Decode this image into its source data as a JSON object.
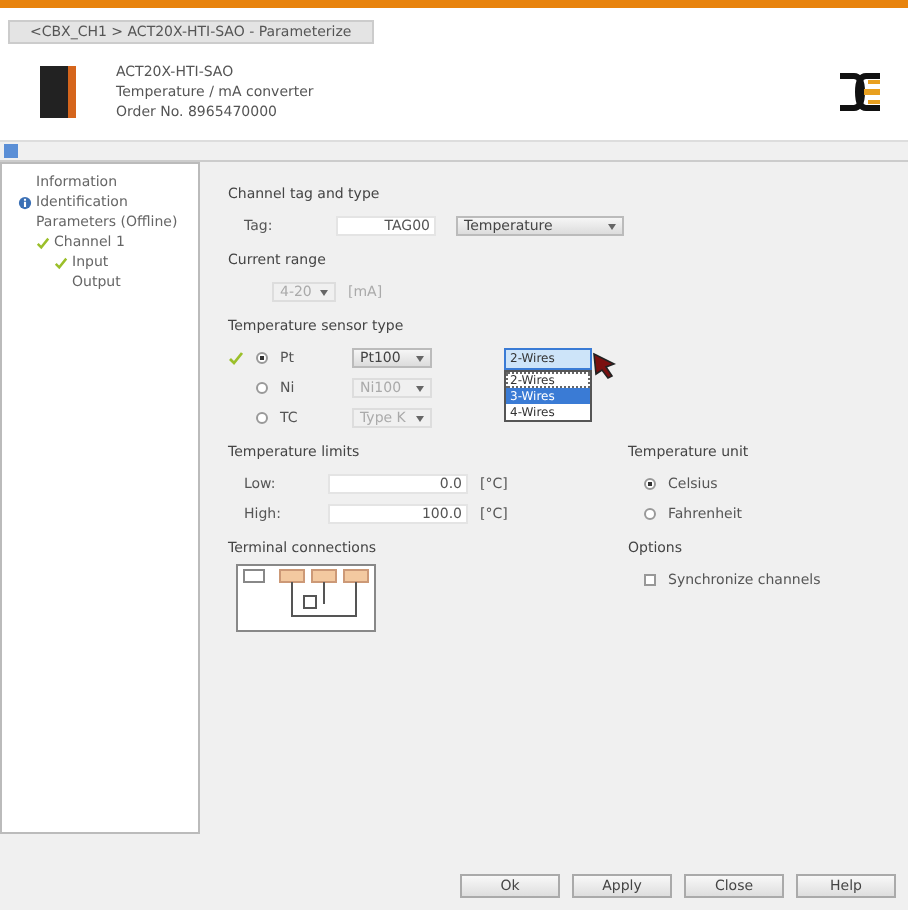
{
  "window": {
    "title": "<CBX_CH1 > ACT20X-HTI-SAO - Parameterize"
  },
  "device": {
    "model": "ACT20X-HTI-SAO",
    "description": "Temperature / mA converter",
    "order_no": "Order No. 8965470000"
  },
  "tree": [
    {
      "label": "Information",
      "kind": "plain"
    },
    {
      "label": "Identification",
      "kind": "info"
    },
    {
      "label": "Parameters (Offline)",
      "kind": "plain",
      "children": [
        {
          "label": "Channel 1",
          "kind": "check",
          "children": [
            {
              "label": "Input",
              "kind": "check"
            },
            {
              "label": "Output",
              "kind": "plain"
            }
          ]
        }
      ]
    }
  ],
  "channel": {
    "heading": "Channel tag and type",
    "tag_label": "Tag:",
    "tag_value": "TAG00",
    "type_value": "Temperature"
  },
  "current_range": {
    "heading": "Current range",
    "value": "4-20",
    "unit": "[mA]",
    "disabled": true
  },
  "sensor": {
    "heading": "Temperature sensor type",
    "rows": [
      {
        "label": "Pt",
        "selected": true,
        "checked": true,
        "type": "Pt100",
        "disabled": false
      },
      {
        "label": "Ni",
        "selected": false,
        "checked": false,
        "type": "Ni100",
        "disabled": true
      },
      {
        "label": "TC",
        "selected": false,
        "checked": false,
        "type": "Type K",
        "disabled": true
      }
    ],
    "wires": {
      "value": "2-Wires",
      "options": [
        {
          "label": "2-Wires",
          "selected": true,
          "highlighted": false
        },
        {
          "label": "3-Wires",
          "selected": false,
          "highlighted": true
        },
        {
          "label": "4-Wires",
          "selected": false,
          "highlighted": false
        }
      ]
    }
  },
  "limits": {
    "heading": "Temperature limits",
    "rows": [
      {
        "label": "Low:",
        "value": "0.0",
        "unit": "[°C]"
      },
      {
        "label": "High:",
        "value": "100.0",
        "unit": "[°C]"
      }
    ]
  },
  "unit": {
    "heading": "Temperature unit",
    "options": [
      {
        "label": "Celsius",
        "selected": true
      },
      {
        "label": "Fahrenheit",
        "selected": false
      }
    ]
  },
  "terminal": {
    "heading": "Terminal connections"
  },
  "options": {
    "heading": "Options",
    "items": [
      {
        "label": "Synchronize channels",
        "checked": false
      }
    ]
  },
  "buttons": [
    "Ok",
    "Apply",
    "Close",
    "Help"
  ]
}
